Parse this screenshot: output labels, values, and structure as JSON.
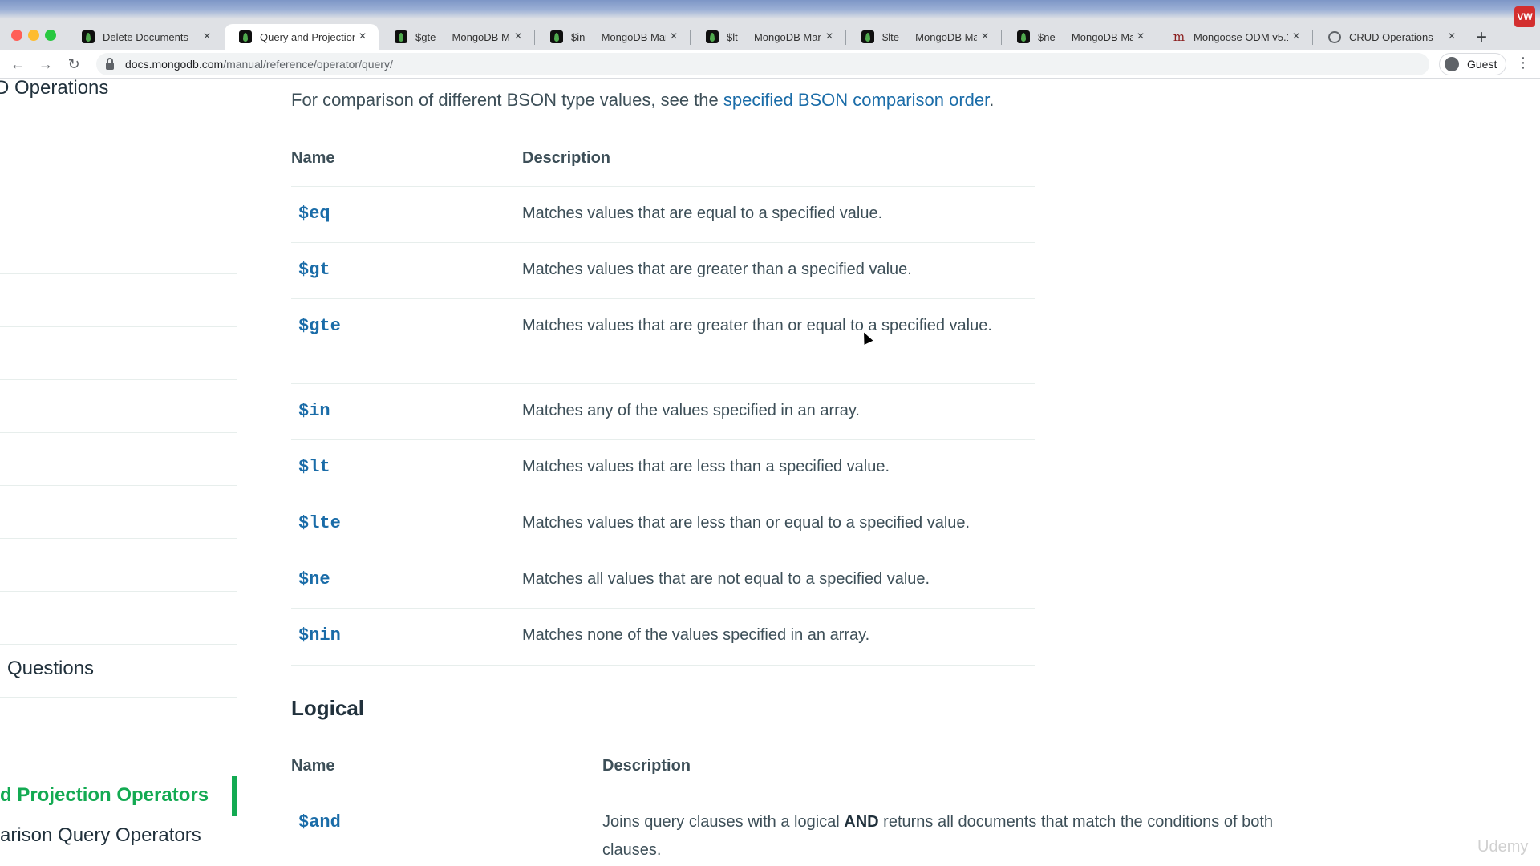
{
  "browser": {
    "tabs": [
      {
        "title": "Delete Documents —",
        "favicon": "mongodb-leaf-icon",
        "active": false
      },
      {
        "title": "Query and Projection",
        "favicon": "mongodb-leaf-icon",
        "active": true
      },
      {
        "title": "$gte — MongoDB M",
        "favicon": "mongodb-leaf-icon",
        "active": false
      },
      {
        "title": "$in — MongoDB Mar",
        "favicon": "mongodb-leaf-icon",
        "active": false
      },
      {
        "title": "$lt — MongoDB Man",
        "favicon": "mongodb-leaf-icon",
        "active": false
      },
      {
        "title": "$lte — MongoDB Ma",
        "favicon": "mongodb-leaf-icon",
        "active": false
      },
      {
        "title": "$ne — MongoDB Ma",
        "favicon": "mongodb-leaf-icon",
        "active": false
      },
      {
        "title": "Mongoose ODM v5.1",
        "favicon": "mongoose-icon",
        "active": false
      },
      {
        "title": "CRUD Operations",
        "favicon": "globe-icon",
        "active": false
      }
    ],
    "new_tab": "+",
    "extension_label": "VW",
    "url_host": "docs.mongodb.com",
    "url_path": "/manual/reference/operator/query/",
    "profile_label": "Guest"
  },
  "sidebar": {
    "items": [
      {
        "label": "D Operations"
      },
      {
        "label": ""
      },
      {
        "label": ""
      },
      {
        "label": ""
      },
      {
        "label": ""
      },
      {
        "label": ""
      },
      {
        "label": ""
      },
      {
        "label": ""
      },
      {
        "label": ""
      },
      {
        "label": ""
      },
      {
        "label": ""
      },
      {
        "label": "Questions"
      },
      {
        "label": ""
      },
      {
        "label": "d Projection Operators",
        "active": true
      },
      {
        "label": "arison Query Operators"
      }
    ]
  },
  "main": {
    "intro": {
      "text": "For comparison of different BSON type values, see the ",
      "link": "specified BSON comparison order",
      "after": "."
    },
    "comparison_table": {
      "headers": [
        "Name",
        "Description"
      ],
      "rows": [
        {
          "name": "$eq",
          "desc": "Matches values that are equal to a specified value."
        },
        {
          "name": "$gt",
          "desc": "Matches values that are greater than a specified value."
        },
        {
          "name": "$gte",
          "desc": "Matches values that are greater than or equal to a specified value."
        },
        {
          "name": "$in",
          "desc": "Matches any of the values specified in an array."
        },
        {
          "name": "$lt",
          "desc": "Matches values that are less than a specified value."
        },
        {
          "name": "$lte",
          "desc": "Matches values that are less than or equal to a specified value."
        },
        {
          "name": "$ne",
          "desc": "Matches all values that are not equal to a specified value."
        },
        {
          "name": "$nin",
          "desc": "Matches none of the values specified in an array."
        }
      ]
    },
    "logical_heading": "Logical",
    "logical_table": {
      "headers": [
        "Name",
        "Description"
      ],
      "rows": [
        {
          "name": "$and",
          "desc_before": "Joins query clauses with a logical ",
          "desc_bold": "AND",
          "desc_after": " returns all documents that match the conditions of both clauses."
        }
      ]
    }
  },
  "watermark": "Udemy",
  "colors": {
    "link": "#1a6ca8",
    "active_green": "#13aa52",
    "text": "#3d4f58"
  }
}
